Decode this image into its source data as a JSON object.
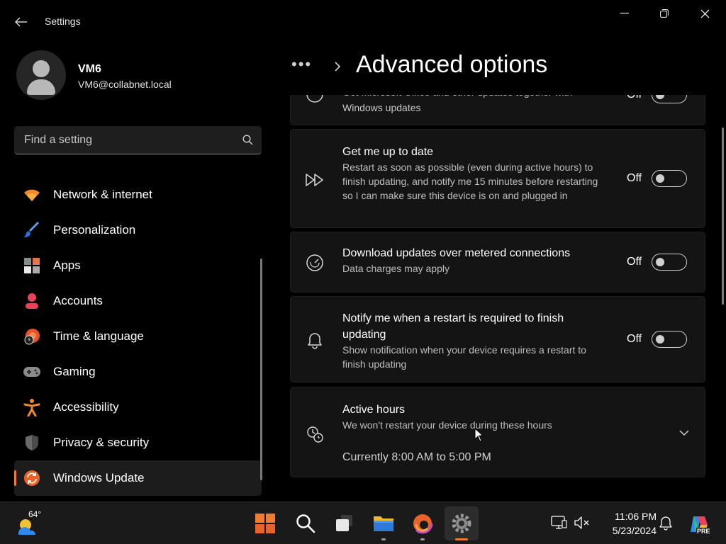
{
  "window": {
    "app_title": "Settings",
    "back_icon": "back-arrow-icon",
    "controls": [
      "minimize-icon",
      "restore-icon",
      "close-icon"
    ]
  },
  "profile": {
    "name": "VM6",
    "email": "VM6@collabnet.local"
  },
  "search": {
    "placeholder": "Find a setting",
    "value": ""
  },
  "nav": {
    "items": [
      {
        "label": "Network & internet",
        "icon": "wifi-icon"
      },
      {
        "label": "Personalization",
        "icon": "brush-icon"
      },
      {
        "label": "Apps",
        "icon": "apps-icon"
      },
      {
        "label": "Accounts",
        "icon": "accounts-icon"
      },
      {
        "label": "Time & language",
        "icon": "globe-clock-icon"
      },
      {
        "label": "Gaming",
        "icon": "gamepad-icon"
      },
      {
        "label": "Accessibility",
        "icon": "accessibility-icon"
      },
      {
        "label": "Privacy & security",
        "icon": "shield-icon"
      },
      {
        "label": "Windows Update",
        "icon": "update-icon",
        "active": true
      }
    ]
  },
  "header": {
    "breadcrumb_overflow": "•••",
    "title": "Advanced options"
  },
  "cards": {
    "office_updates": {
      "title": "Get Microsoft Office and other updates together with",
      "desc": "Windows updates",
      "toggle_label": "Off"
    },
    "get_up_to_date": {
      "title": "Get me up to date",
      "desc": "Restart as soon as possible (even during active hours) to finish updating, and notify me 15 minutes before restarting so I can make sure this device is on and plugged in",
      "toggle_label": "Off"
    },
    "metered": {
      "title": "Download updates over metered connections",
      "desc": "Data charges may apply",
      "toggle_label": "Off"
    },
    "notify_restart": {
      "title": "Notify me when a restart is required to finish updating",
      "desc": "Show notification when your device requires a restart to finish updating",
      "toggle_label": "Off"
    },
    "active_hours": {
      "title": "Active hours",
      "desc": "We won't restart your device during these hours",
      "current": "Currently 8:00 AM to 5:00 PM"
    }
  },
  "taskbar": {
    "weather_temp": "64°",
    "apps": [
      "start-icon",
      "search-icon",
      "task-view-icon",
      "file-explorer-icon",
      "edge-icon",
      "settings-icon"
    ],
    "tray": [
      "network-display-icon",
      "volume-muted-icon"
    ],
    "time": "11:06 PM",
    "date": "5/23/2024",
    "copilot_badge": "PRE"
  },
  "colors": {
    "accent": "#f07c30",
    "background": "#000000",
    "card": "#141414"
  }
}
